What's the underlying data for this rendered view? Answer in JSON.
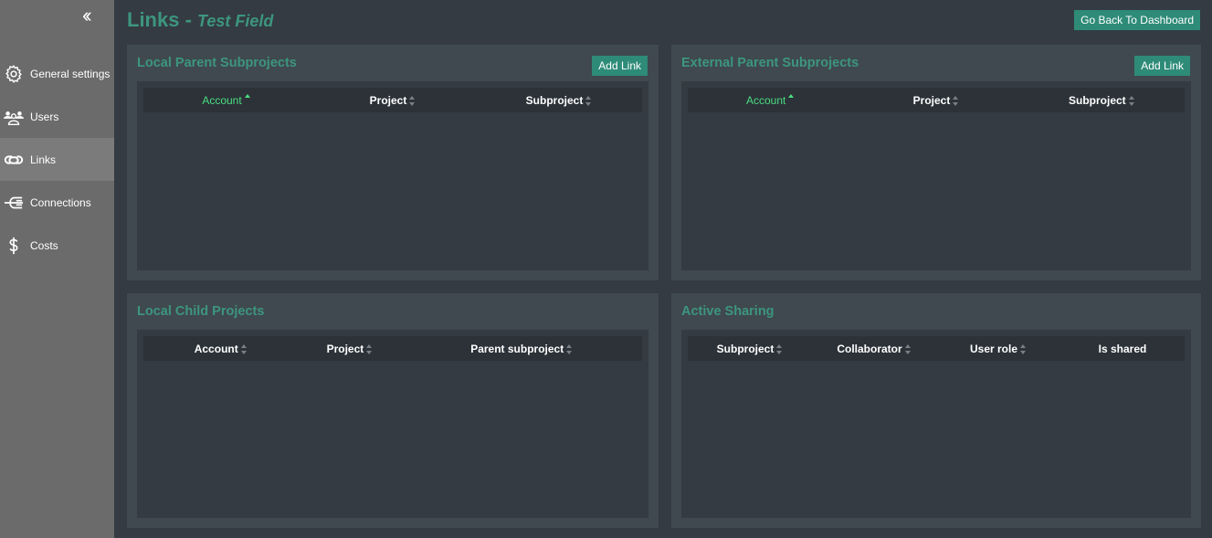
{
  "sidebar": {
    "collapse_icon": "double-chevron-left-icon",
    "items": [
      {
        "label": "General settings",
        "icon": "gear-icon"
      },
      {
        "label": "Users",
        "icon": "users-icon"
      },
      {
        "label": "Links",
        "icon": "link-icon",
        "active": true
      },
      {
        "label": "Connections",
        "icon": "connections-icon"
      },
      {
        "label": "Costs",
        "icon": "dollar-icon"
      }
    ]
  },
  "header": {
    "title": "Links -",
    "subtitle": "Test Field",
    "back_button": "Go Back To Dashboard"
  },
  "panels": {
    "local_parent": {
      "title": "Local Parent Subprojects",
      "add_label": "Add Link",
      "columns": [
        "Account",
        "Project",
        "Subproject"
      ],
      "sorted_column": "Account",
      "rows": []
    },
    "external_parent": {
      "title": "External Parent Subprojects",
      "add_label": "Add Link",
      "columns": [
        "Account",
        "Project",
        "Subproject"
      ],
      "sorted_column": "Account",
      "rows": []
    },
    "local_child": {
      "title": "Local Child Projects",
      "columns": [
        "Account",
        "Project",
        "Parent subproject"
      ],
      "rows": []
    },
    "active_sharing": {
      "title": "Active Sharing",
      "columns": [
        "Subproject",
        "Collaborator",
        "User role",
        "Is shared"
      ],
      "rows": []
    }
  },
  "colors": {
    "accent": "#2e8b78",
    "title": "#3d9580",
    "sorted": "#4ade80"
  }
}
